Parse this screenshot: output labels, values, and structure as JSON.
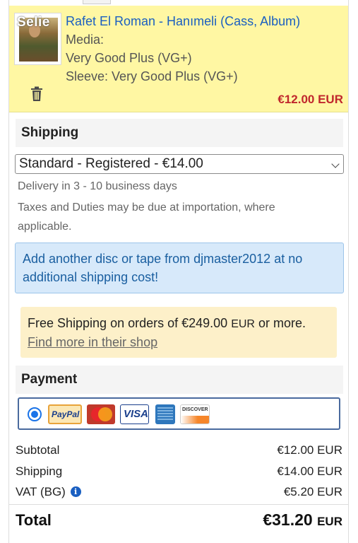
{
  "item": {
    "thumb_overlay": "Selie",
    "title": "Rafet El Roman - Hanımeli (Cass, Album)",
    "media_label": "Media:",
    "media_grade": "Very Good Plus (VG+)",
    "sleeve": "Sleeve: Very Good Plus (VG+)",
    "price": "€12.00 EUR",
    "delete_icon": "trash-icon"
  },
  "shipping": {
    "heading": "Shipping",
    "selected_option": "Standard - Registered - €14.00",
    "delivery": "Delivery in 3 - 10 business days",
    "taxes_line1": "Taxes and Duties may be due at importation, where",
    "taxes_line2": "applicable.",
    "info_line1": "Add another disc or tape from djmaster2012 at no",
    "info_line2": "additional shipping cost!",
    "promo_text": "Free Shipping on orders of €249.00 ",
    "promo_eur": "EUR",
    "promo_tail": " or more.",
    "promo_link": "Find more in their shop"
  },
  "payment": {
    "heading": "Payment",
    "paypal_label": "PayPal",
    "visa_label": "VISA",
    "discover_label": "DISCOVER",
    "methods": [
      "paypal-icon",
      "mastercard-icon",
      "visa-icon",
      "amex-icon",
      "discover-icon"
    ]
  },
  "summary": {
    "subtotal_label": "Subtotal",
    "subtotal_value": "€12.00 EUR",
    "shipping_label": "Shipping",
    "shipping_value": "€14.00 EUR",
    "vat_label": "VAT (BG)",
    "vat_value": "€5.20 EUR",
    "total_label": "Total",
    "total_value": "€31.20",
    "total_currency": "EUR"
  },
  "colors": {
    "item_bg": "#fff7a3",
    "link": "#1a5fc1",
    "price": "#c0272d",
    "info_bg": "#d7e9fa",
    "promo_bg": "#fdf0c9",
    "radio": "#1a73e8"
  }
}
